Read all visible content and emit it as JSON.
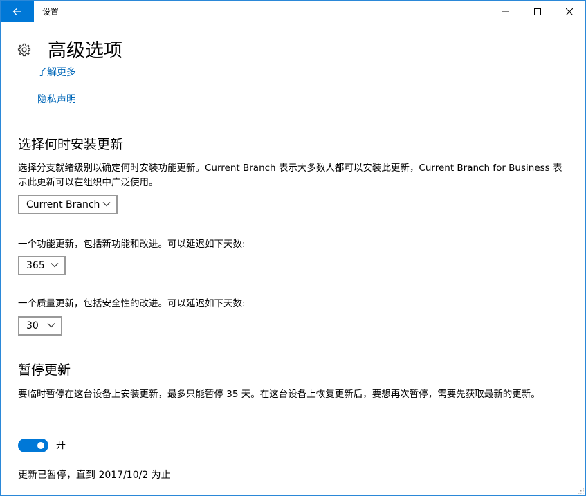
{
  "window": {
    "title": "设置"
  },
  "page": {
    "title": "高级选项",
    "link_learn_more": "了解更多",
    "link_privacy": "隐私声明"
  },
  "install_section": {
    "title": "选择何时安装更新",
    "description": "选择分支就绪级别以确定何时安装功能更新。Current Branch 表示大多数人都可以安装此更新，Current Branch for Business 表示此更新可以在组织中广泛使用。",
    "branch_select": "Current Branch",
    "feature_label": "一个功能更新，包括新功能和改进。可以延迟如下天数:",
    "feature_days": "365",
    "quality_label": "一个质量更新，包括安全性的改进。可以延迟如下天数:",
    "quality_days": "30"
  },
  "pause_section": {
    "title": "暂停更新",
    "description": "要临时暂停在这台设备上安装更新，最多只能暂停 35 天。在这台设备上恢复更新后，要想再次暂停，需要先获取最新的更新。",
    "toggle_state": "开",
    "toggle_on": true,
    "status": "更新已暂停，直到 2017/10/2 为止"
  },
  "icons": {
    "back": "back-arrow-icon",
    "settings": "gear-icon",
    "minimize": "minimize-icon",
    "maximize": "maximize-icon",
    "close": "close-icon",
    "dropdown": "chevron-down-icon"
  },
  "colors": {
    "accent": "#0078d7",
    "link": "#0067b8",
    "border": "#999999"
  }
}
